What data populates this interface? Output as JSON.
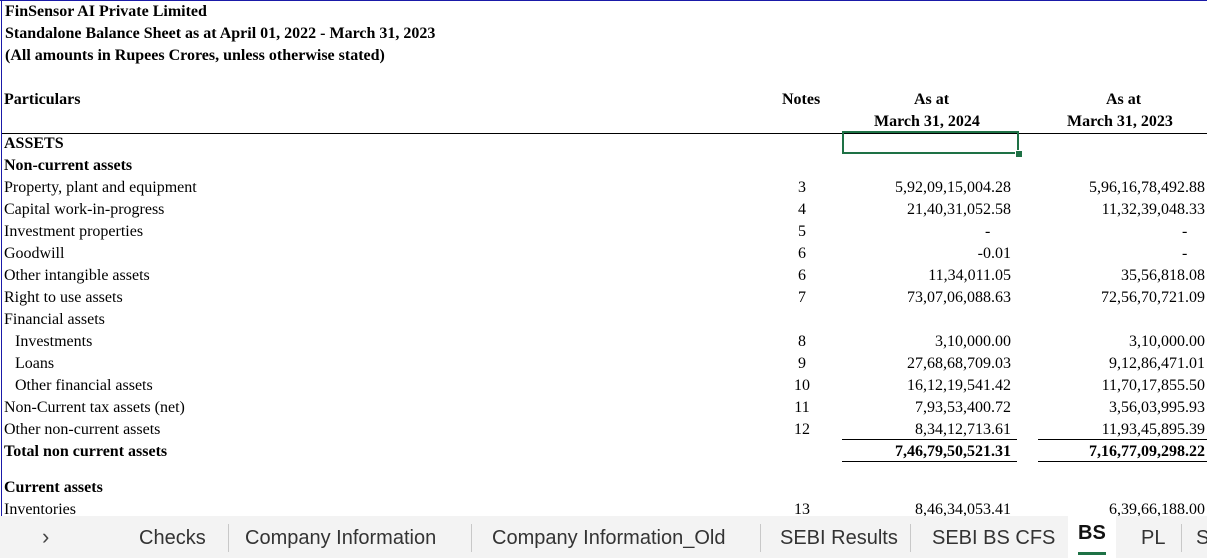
{
  "header": {
    "company": "FinSensor AI Private Limited",
    "statement": "Standalone Balance Sheet as at April 01, 2022 - March 31, 2023",
    "note": "(All amounts in Rupees Crores, unless otherwise stated)"
  },
  "columns": {
    "particulars": "Particulars",
    "notes": "Notes",
    "col1_line1": "As at",
    "col1_line2": "March 31, 2024",
    "col2_line1": "As at",
    "col2_line2": "March 31, 2023"
  },
  "rows": [
    {
      "label": "ASSETS",
      "note": "",
      "v1": "",
      "v2": ""
    },
    {
      "label": "Non-current assets",
      "note": "",
      "v1": "",
      "v2": ""
    },
    {
      "label": "Property, plant and equipment",
      "note": "3",
      "v1": "5,92,09,15,004.28",
      "v2": "5,96,16,78,492.88"
    },
    {
      "label": "Capital work-in-progress",
      "note": "4",
      "v1": "21,40,31,052.58",
      "v2": "11,32,39,048.33"
    },
    {
      "label": "Investment properties",
      "note": "5",
      "v1": "-",
      "v2": "-"
    },
    {
      "label": "Goodwill",
      "note": "6",
      "v1": "-0.01",
      "v2": "-"
    },
    {
      "label": "Other intangible assets",
      "note": "6",
      "v1": "11,34,011.05",
      "v2": "35,56,818.08"
    },
    {
      "label": "Right to use assets",
      "note": "7",
      "v1": "73,07,06,088.63",
      "v2": "72,56,70,721.09"
    },
    {
      "label": "Financial assets",
      "note": "",
      "v1": "",
      "v2": ""
    },
    {
      "label": "Investments",
      "note": "8",
      "v1": "3,10,000.00",
      "v2": "3,10,000.00"
    },
    {
      "label": "Loans",
      "note": "9",
      "v1": "27,68,68,709.03",
      "v2": "9,12,86,471.01"
    },
    {
      "label": "Other financial assets",
      "note": "10",
      "v1": "16,12,19,541.42",
      "v2": "11,70,17,855.50"
    },
    {
      "label": "Non-Current tax assets (net)",
      "note": "11",
      "v1": "7,93,53,400.72",
      "v2": "3,56,03,995.93"
    },
    {
      "label": "Other non-current assets",
      "note": "12",
      "v1": "8,34,12,713.61",
      "v2": "11,93,45,895.39"
    },
    {
      "label": "Total non current assets",
      "note": "",
      "v1": "7,46,79,50,521.31",
      "v2": "7,16,77,09,298.22"
    },
    {
      "label": "Current assets",
      "note": "",
      "v1": "",
      "v2": ""
    },
    {
      "label": "Inventories",
      "note": "13",
      "v1": "8,46,34,053.41",
      "v2": "6,39,66,188.00"
    }
  ],
  "tabs": {
    "prev": "‹",
    "next": "›",
    "items": [
      "Checks",
      "Company Information",
      "Company Information_Old",
      "SEBI Results",
      "SEBI BS CFS",
      "BS",
      "PL",
      "S"
    ]
  }
}
